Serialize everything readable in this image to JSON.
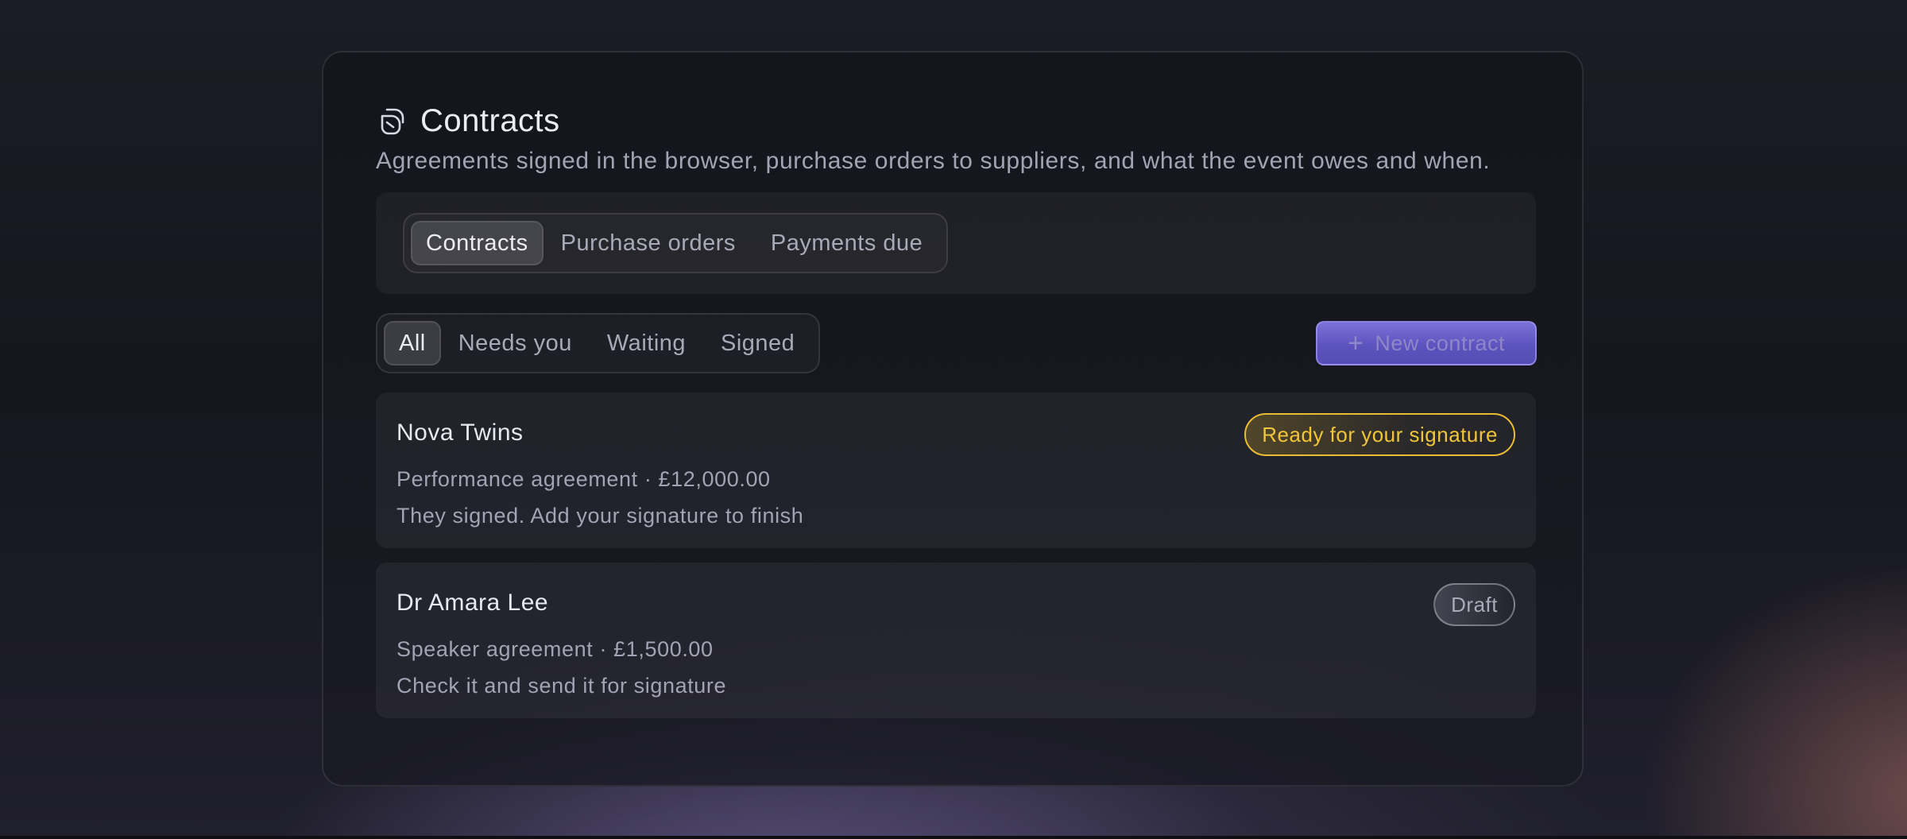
{
  "header": {
    "title": "Contracts",
    "subtitle": "Agreements signed in the browser, purchase orders to suppliers, and what the event owes and when.",
    "icon": "contracts-icon"
  },
  "tabs": [
    {
      "label": "Contracts",
      "active": true
    },
    {
      "label": "Purchase orders",
      "active": false
    },
    {
      "label": "Payments due",
      "active": false
    }
  ],
  "filters": [
    {
      "label": "All",
      "active": true
    },
    {
      "label": "Needs you",
      "active": false
    },
    {
      "label": "Waiting",
      "active": false
    },
    {
      "label": "Signed",
      "active": false
    }
  ],
  "new_button": {
    "label": "New contract",
    "icon": "plus-icon"
  },
  "contracts": [
    {
      "name": "Nova Twins",
      "meta": "Performance agreement · £12,000.00",
      "note": "They signed. Add your signature to finish",
      "status": "Ready for your signature",
      "status_color": "#f0c53a"
    },
    {
      "name": "Dr Amara Lee",
      "meta": "Speaker agreement · £1,500.00",
      "note": "Check it and send it for signature",
      "status": "Draft",
      "status_color": "#a9a9b8"
    }
  ],
  "colors": {
    "accent": "#6a61cc",
    "warning": "#e9bd33"
  }
}
